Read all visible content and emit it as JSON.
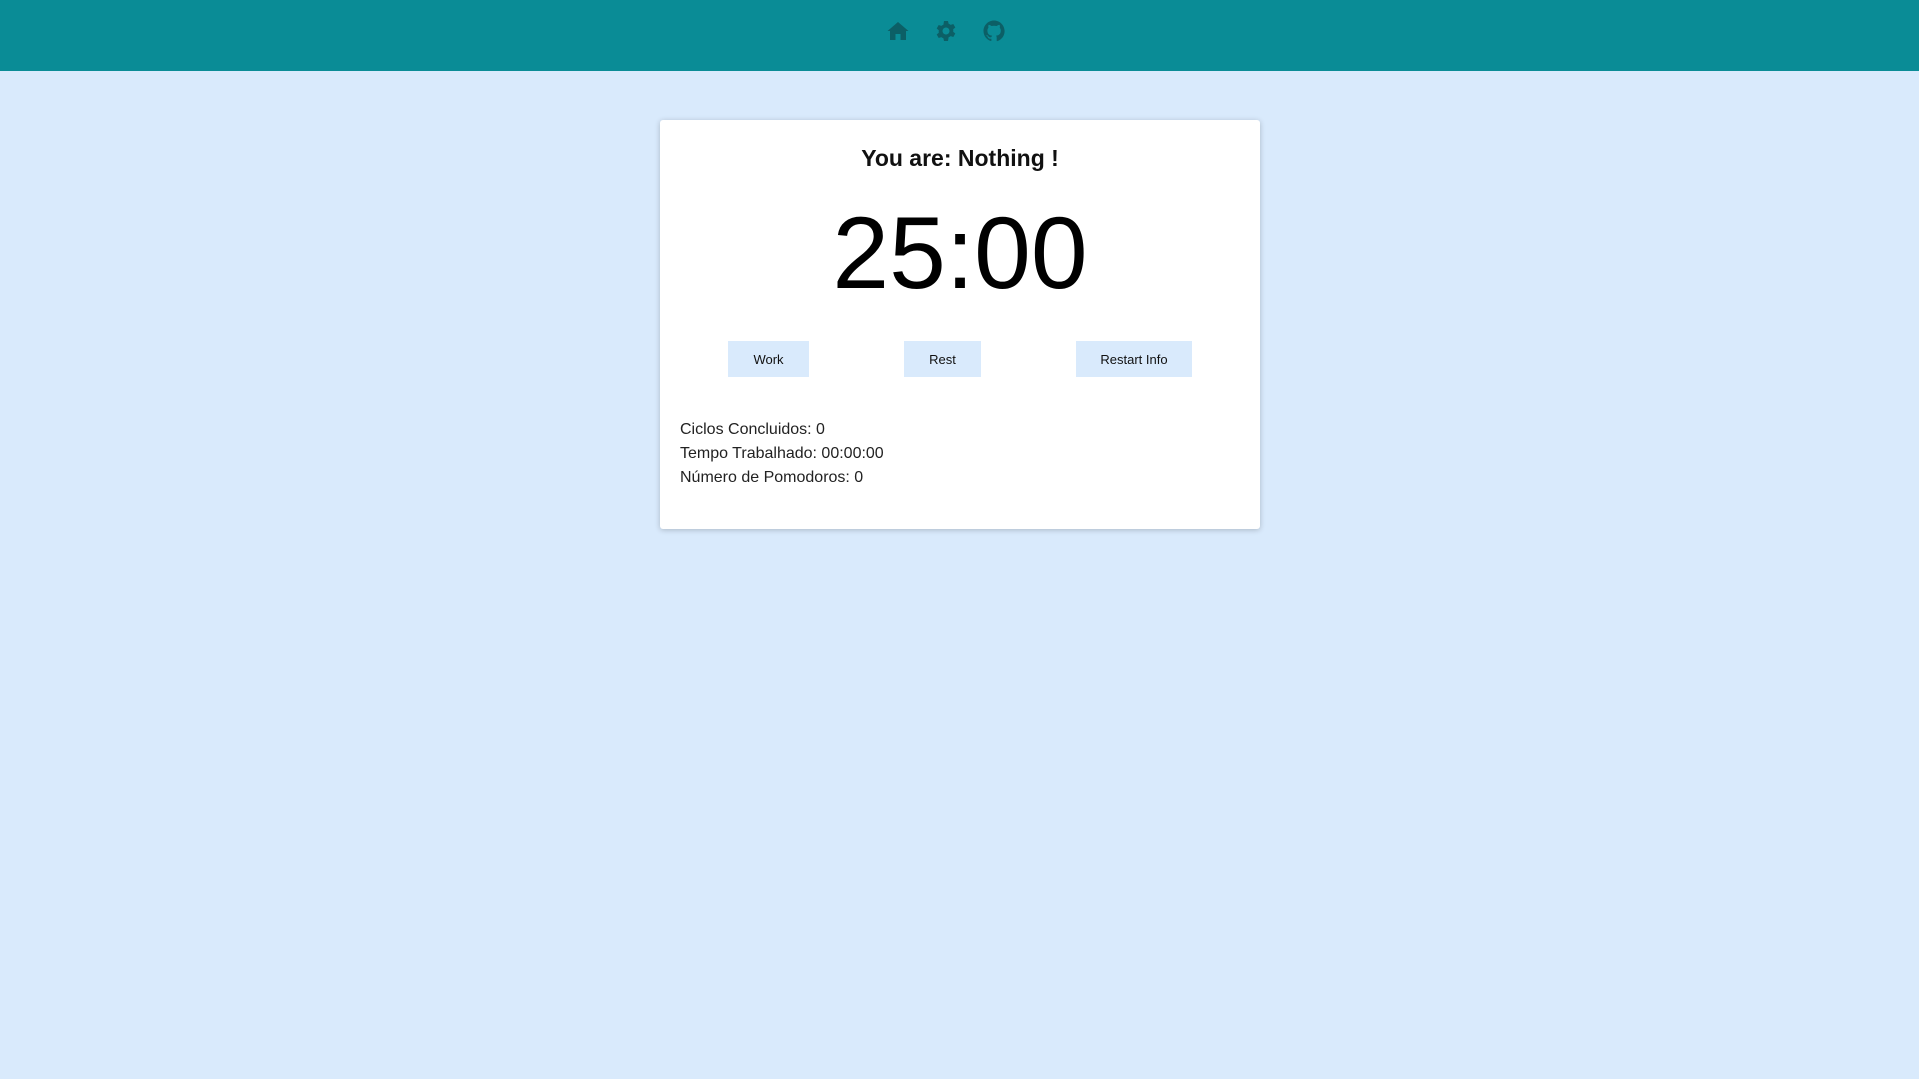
{
  "header": {
    "icons": [
      "home-icon",
      "gear-icon",
      "github-icon"
    ],
    "background": "#0a8c96",
    "icon_color": "#0c5f66"
  },
  "card": {
    "status_title": "You are: Nothing !",
    "timer": "25:00",
    "buttons": {
      "work": "Work",
      "rest": "Rest",
      "restart": "Restart Info"
    },
    "stats": {
      "ciclos": "Ciclos Concluidos: 0",
      "tempo": "Tempo Trabalhado: 00:00:00",
      "pomodoros": "Número de Pomodoros: 0"
    }
  },
  "colors": {
    "page_background": "#d9eafc",
    "button_background": "#d9eafc"
  }
}
